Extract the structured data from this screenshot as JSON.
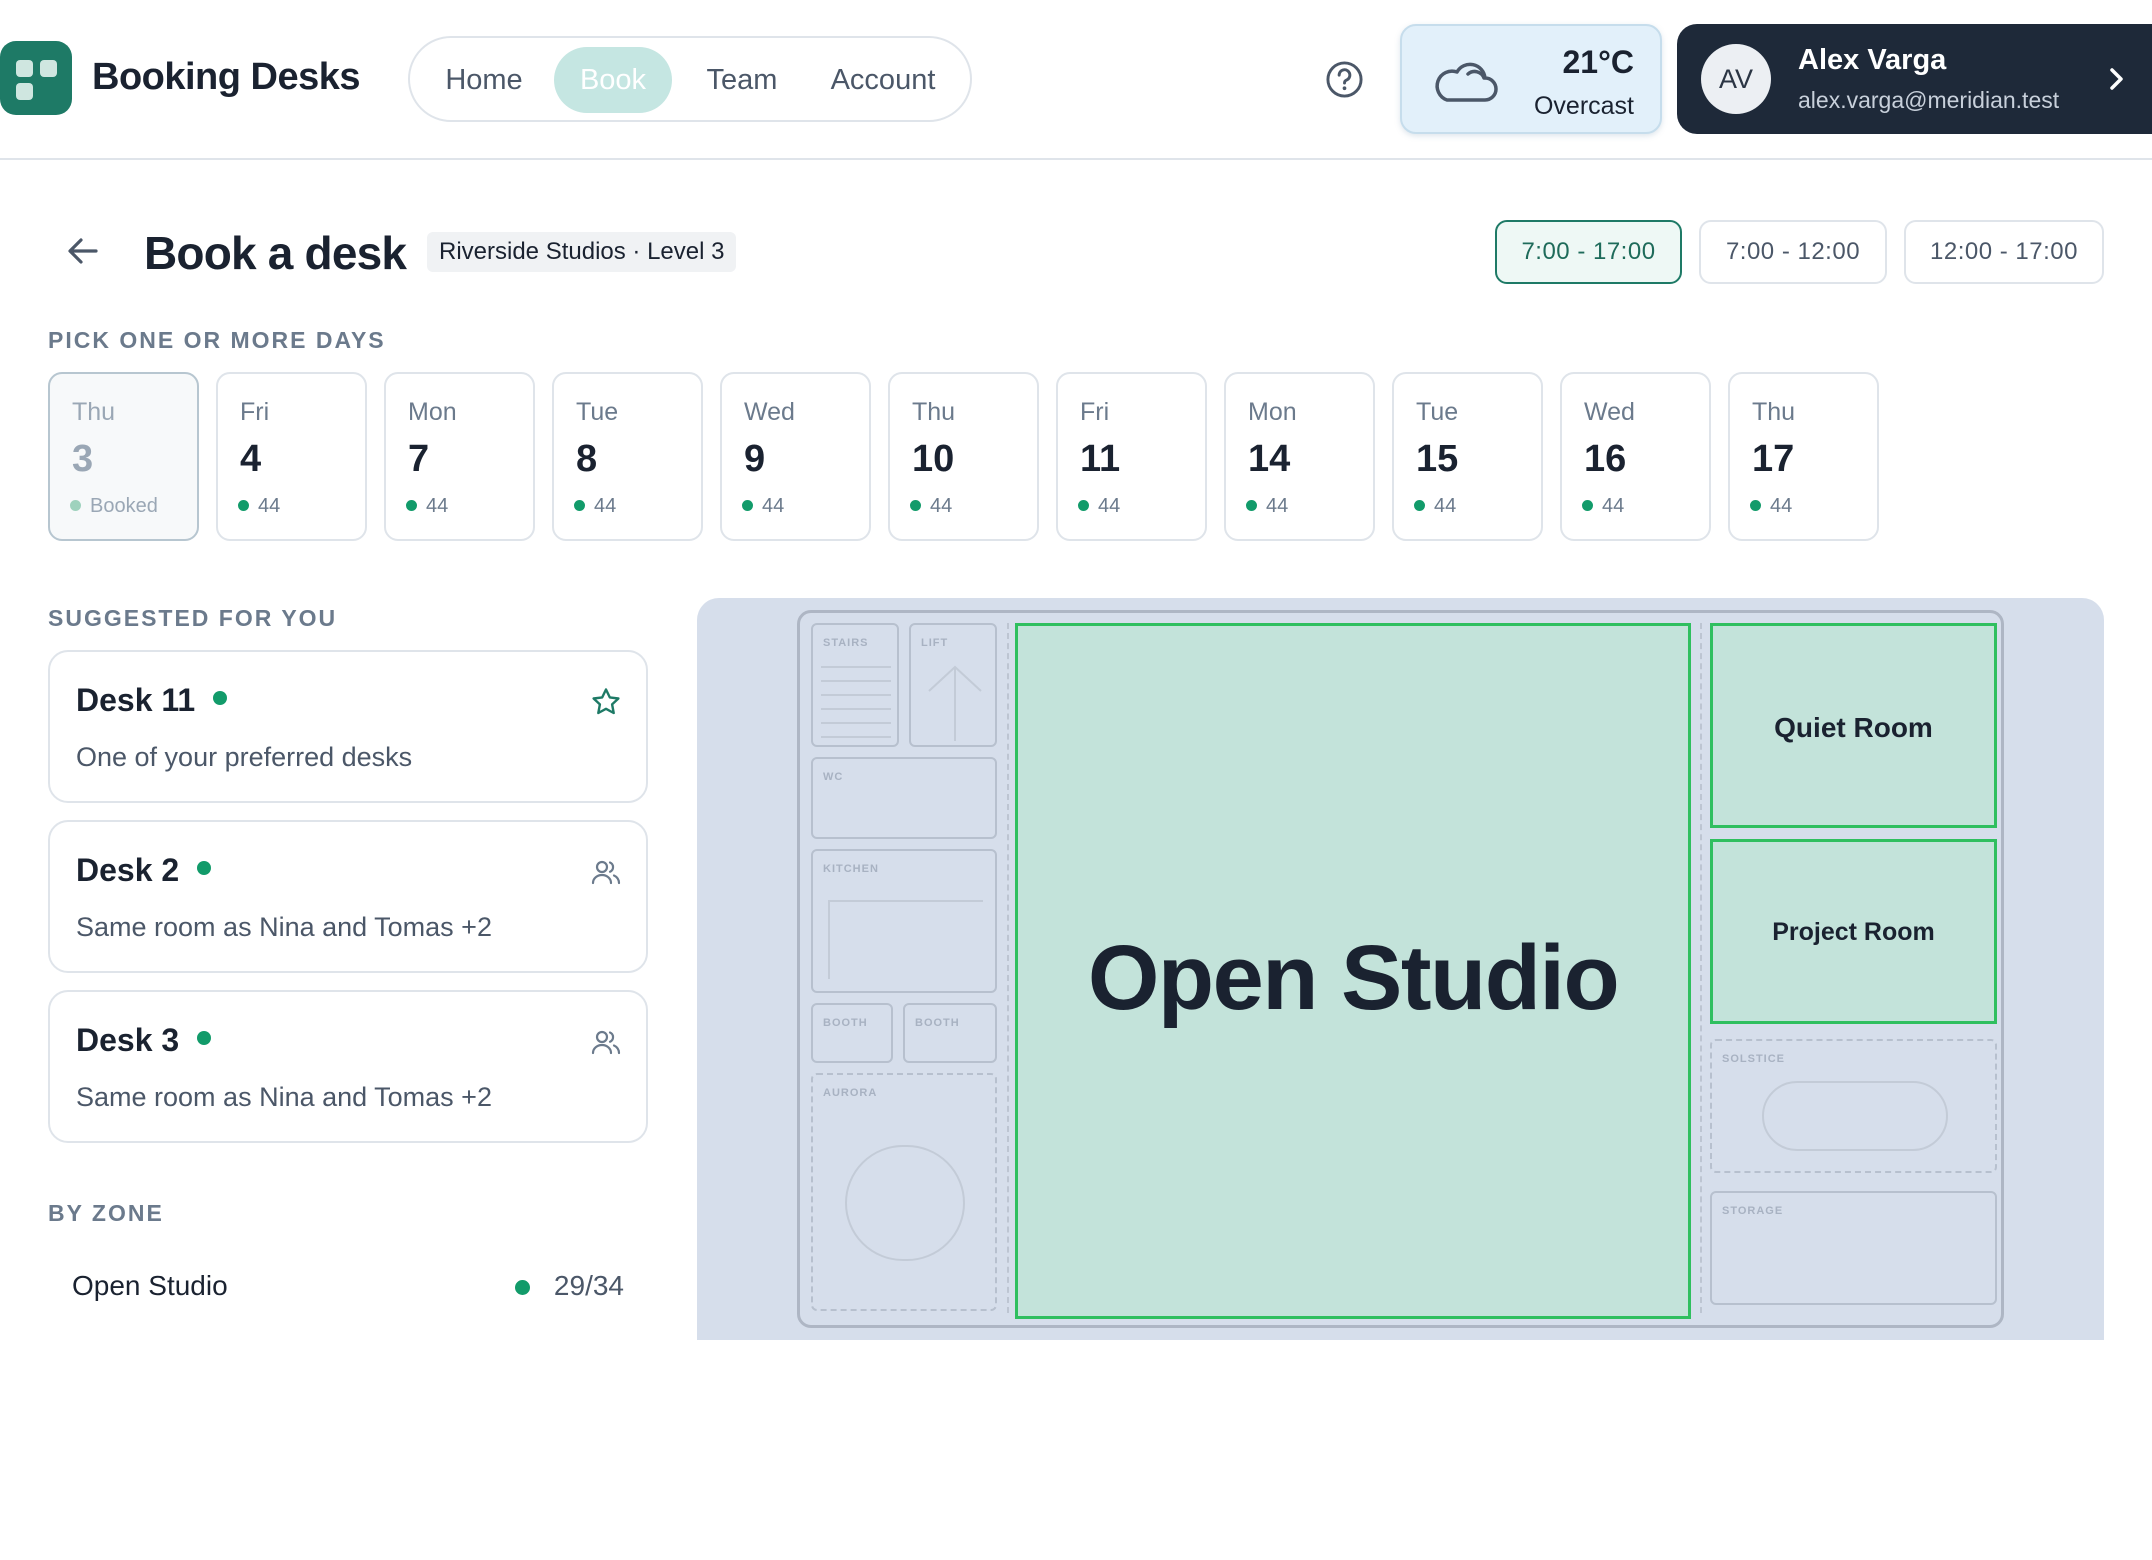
{
  "app": {
    "title": "Booking Desks"
  },
  "nav": {
    "items": [
      "Home",
      "Book",
      "Team",
      "Account"
    ],
    "active": "Book"
  },
  "weather": {
    "temperature": "21°C",
    "condition": "Overcast",
    "icon": "cloud-icon"
  },
  "user": {
    "initials": "AV",
    "name": "Alex Varga",
    "email": "alex.varga@meridian.test"
  },
  "page": {
    "title": "Book a desk",
    "location": "Riverside Studios · Level 3"
  },
  "time_slots": [
    "7:00 - 17:00",
    "7:00 - 12:00",
    "12:00 - 17:00"
  ],
  "days_label": "PICK ONE OR MORE DAYS",
  "days": [
    {
      "dow": "Thu",
      "num": "3",
      "status": "Booked"
    },
    {
      "dow": "Fri",
      "num": "4",
      "status": "44"
    },
    {
      "dow": "Mon",
      "num": "7",
      "status": "44"
    },
    {
      "dow": "Tue",
      "num": "8",
      "status": "44"
    },
    {
      "dow": "Wed",
      "num": "9",
      "status": "44"
    },
    {
      "dow": "Thu",
      "num": "10",
      "status": "44"
    },
    {
      "dow": "Fri",
      "num": "11",
      "status": "44"
    },
    {
      "dow": "Mon",
      "num": "14",
      "status": "44"
    },
    {
      "dow": "Tue",
      "num": "15",
      "status": "44"
    },
    {
      "dow": "Wed",
      "num": "16",
      "status": "44"
    },
    {
      "dow": "Thu",
      "num": "17",
      "status": "44"
    }
  ],
  "suggested": {
    "label": "SUGGESTED FOR YOU",
    "items": [
      {
        "name": "Desk 11",
        "reason": "One of your preferred desks",
        "icon": "star-icon"
      },
      {
        "name": "Desk 2",
        "reason": "Same room as Nina and Tomas +2",
        "icon": "people-icon"
      },
      {
        "name": "Desk 3",
        "reason": "Same room as Nina and Tomas +2",
        "icon": "people-icon"
      }
    ]
  },
  "by_zone": {
    "label": "BY ZONE",
    "items": [
      {
        "name": "Open Studio",
        "count": "29/34"
      }
    ]
  },
  "floor_plan": {
    "zones": [
      "Open Studio",
      "Quiet Room",
      "Project Room"
    ],
    "rooms": [
      "STAIRS",
      "LIFT",
      "WC",
      "KITCHEN",
      "BOOTH",
      "BOOTH",
      "AURORA",
      "SOLSTICE",
      "STORAGE"
    ]
  },
  "colors": {
    "accent": "#1e7a66",
    "available": "#129b6a",
    "zone_fill": "#c3e3da",
    "zone_border": "#2fbf5f",
    "user_bg": "#1e2939"
  }
}
